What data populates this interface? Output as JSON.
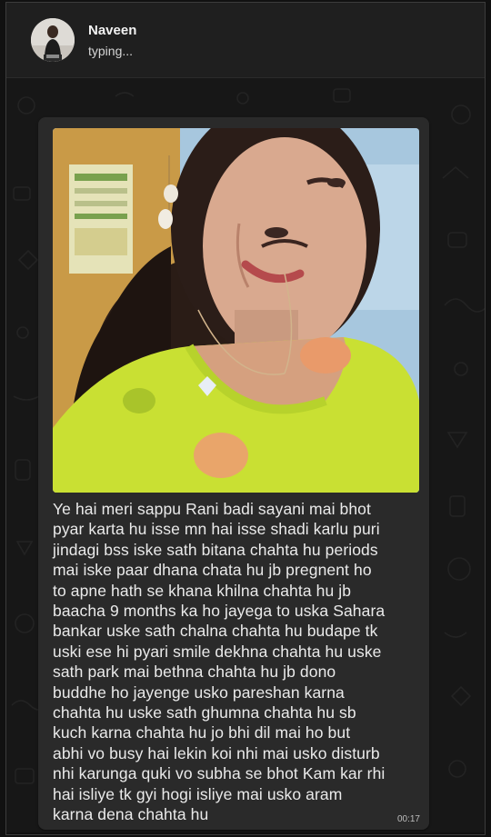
{
  "header": {
    "contact_name": "Naveen",
    "contact_status": "typing...",
    "avatar_icon": "user-avatar-photo"
  },
  "message": {
    "image_icon": "portrait-photo",
    "text": "Ye hai meri sappu Rani badi sayani mai bhot\npyar karta hu isse mn hai isse shadi karlu puri\njindagi bss iske sath bitana chahta hu periods\nmai iske paar dhana chata hu jb pregnent ho\nto apne hath se khana khilna chahta hu jb\nbaacha 9 months ka ho jayega to uska Sahara\nbankar uske sath chalna chahta hu budape tk\nuski ese hi pyari smile dekhna chahta hu uske\nsath park mai bethna chahta hu jb dono\nbuddhe ho jayenge usko pareshan karna\nchahta hu uske sath ghumna chahta hu sb\nkuch karna chahta hu jo bhi dil mai ho but\nabhi vo busy hai lekin koi nhi mai usko disturb\nnhi karunga quki vo subha se bhot Kam kar rhi\nhai isliye tk gyi hogi isliye mai usko aram\nkarna dena chahta hu",
    "time": "00:17"
  },
  "colors": {
    "bubble": "#2a2a2a",
    "header": "#1f1f1f",
    "chat_background": "#171717",
    "text": "#eaeaea"
  }
}
